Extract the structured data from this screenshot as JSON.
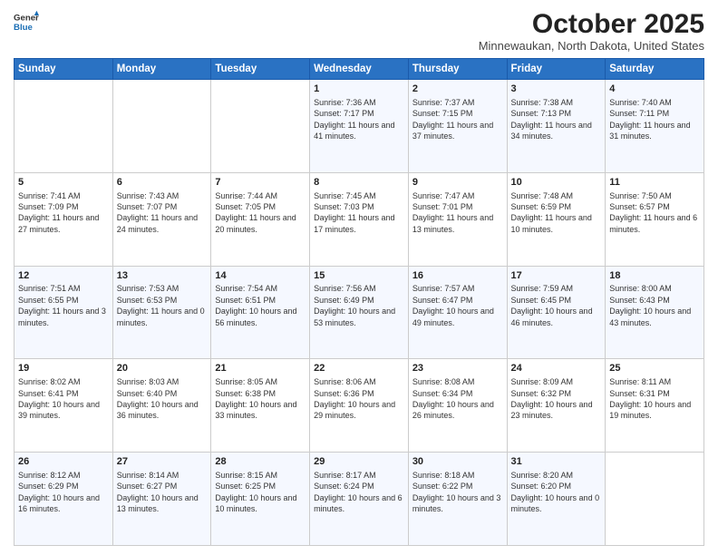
{
  "header": {
    "logo_line1": "General",
    "logo_line2": "Blue",
    "month": "October 2025",
    "location": "Minnewaukan, North Dakota, United States"
  },
  "days_of_week": [
    "Sunday",
    "Monday",
    "Tuesday",
    "Wednesday",
    "Thursday",
    "Friday",
    "Saturday"
  ],
  "weeks": [
    [
      {
        "day": "",
        "info": ""
      },
      {
        "day": "",
        "info": ""
      },
      {
        "day": "",
        "info": ""
      },
      {
        "day": "1",
        "info": "Sunrise: 7:36 AM\nSunset: 7:17 PM\nDaylight: 11 hours\nand 41 minutes."
      },
      {
        "day": "2",
        "info": "Sunrise: 7:37 AM\nSunset: 7:15 PM\nDaylight: 11 hours\nand 37 minutes."
      },
      {
        "day": "3",
        "info": "Sunrise: 7:38 AM\nSunset: 7:13 PM\nDaylight: 11 hours\nand 34 minutes."
      },
      {
        "day": "4",
        "info": "Sunrise: 7:40 AM\nSunset: 7:11 PM\nDaylight: 11 hours\nand 31 minutes."
      }
    ],
    [
      {
        "day": "5",
        "info": "Sunrise: 7:41 AM\nSunset: 7:09 PM\nDaylight: 11 hours\nand 27 minutes."
      },
      {
        "day": "6",
        "info": "Sunrise: 7:43 AM\nSunset: 7:07 PM\nDaylight: 11 hours\nand 24 minutes."
      },
      {
        "day": "7",
        "info": "Sunrise: 7:44 AM\nSunset: 7:05 PM\nDaylight: 11 hours\nand 20 minutes."
      },
      {
        "day": "8",
        "info": "Sunrise: 7:45 AM\nSunset: 7:03 PM\nDaylight: 11 hours\nand 17 minutes."
      },
      {
        "day": "9",
        "info": "Sunrise: 7:47 AM\nSunset: 7:01 PM\nDaylight: 11 hours\nand 13 minutes."
      },
      {
        "day": "10",
        "info": "Sunrise: 7:48 AM\nSunset: 6:59 PM\nDaylight: 11 hours\nand 10 minutes."
      },
      {
        "day": "11",
        "info": "Sunrise: 7:50 AM\nSunset: 6:57 PM\nDaylight: 11 hours\nand 6 minutes."
      }
    ],
    [
      {
        "day": "12",
        "info": "Sunrise: 7:51 AM\nSunset: 6:55 PM\nDaylight: 11 hours\nand 3 minutes."
      },
      {
        "day": "13",
        "info": "Sunrise: 7:53 AM\nSunset: 6:53 PM\nDaylight: 11 hours\nand 0 minutes."
      },
      {
        "day": "14",
        "info": "Sunrise: 7:54 AM\nSunset: 6:51 PM\nDaylight: 10 hours\nand 56 minutes."
      },
      {
        "day": "15",
        "info": "Sunrise: 7:56 AM\nSunset: 6:49 PM\nDaylight: 10 hours\nand 53 minutes."
      },
      {
        "day": "16",
        "info": "Sunrise: 7:57 AM\nSunset: 6:47 PM\nDaylight: 10 hours\nand 49 minutes."
      },
      {
        "day": "17",
        "info": "Sunrise: 7:59 AM\nSunset: 6:45 PM\nDaylight: 10 hours\nand 46 minutes."
      },
      {
        "day": "18",
        "info": "Sunrise: 8:00 AM\nSunset: 6:43 PM\nDaylight: 10 hours\nand 43 minutes."
      }
    ],
    [
      {
        "day": "19",
        "info": "Sunrise: 8:02 AM\nSunset: 6:41 PM\nDaylight: 10 hours\nand 39 minutes."
      },
      {
        "day": "20",
        "info": "Sunrise: 8:03 AM\nSunset: 6:40 PM\nDaylight: 10 hours\nand 36 minutes."
      },
      {
        "day": "21",
        "info": "Sunrise: 8:05 AM\nSunset: 6:38 PM\nDaylight: 10 hours\nand 33 minutes."
      },
      {
        "day": "22",
        "info": "Sunrise: 8:06 AM\nSunset: 6:36 PM\nDaylight: 10 hours\nand 29 minutes."
      },
      {
        "day": "23",
        "info": "Sunrise: 8:08 AM\nSunset: 6:34 PM\nDaylight: 10 hours\nand 26 minutes."
      },
      {
        "day": "24",
        "info": "Sunrise: 8:09 AM\nSunset: 6:32 PM\nDaylight: 10 hours\nand 23 minutes."
      },
      {
        "day": "25",
        "info": "Sunrise: 8:11 AM\nSunset: 6:31 PM\nDaylight: 10 hours\nand 19 minutes."
      }
    ],
    [
      {
        "day": "26",
        "info": "Sunrise: 8:12 AM\nSunset: 6:29 PM\nDaylight: 10 hours\nand 16 minutes."
      },
      {
        "day": "27",
        "info": "Sunrise: 8:14 AM\nSunset: 6:27 PM\nDaylight: 10 hours\nand 13 minutes."
      },
      {
        "day": "28",
        "info": "Sunrise: 8:15 AM\nSunset: 6:25 PM\nDaylight: 10 hours\nand 10 minutes."
      },
      {
        "day": "29",
        "info": "Sunrise: 8:17 AM\nSunset: 6:24 PM\nDaylight: 10 hours\nand 6 minutes."
      },
      {
        "day": "30",
        "info": "Sunrise: 8:18 AM\nSunset: 6:22 PM\nDaylight: 10 hours\nand 3 minutes."
      },
      {
        "day": "31",
        "info": "Sunrise: 8:20 AM\nSunset: 6:20 PM\nDaylight: 10 hours\nand 0 minutes."
      },
      {
        "day": "",
        "info": ""
      }
    ]
  ]
}
